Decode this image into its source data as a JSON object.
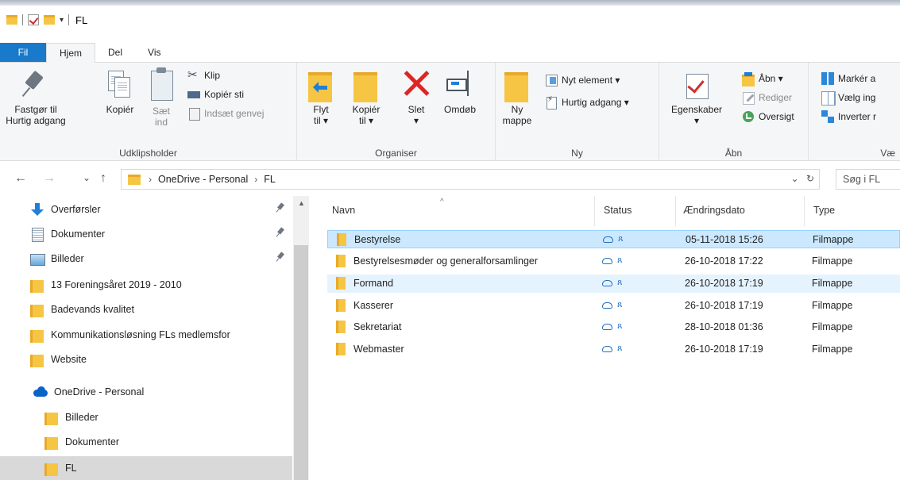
{
  "window": {
    "title": "FL"
  },
  "tabs": [
    {
      "label": "Fil"
    },
    {
      "label": "Hjem"
    },
    {
      "label": "Del"
    },
    {
      "label": "Vis"
    }
  ],
  "ribbon": {
    "clipboard": {
      "group_label": "Udklipsholder",
      "pin_line1": "Fastgør til",
      "pin_line2": "Hurtig adgang",
      "copy": "Kopiér",
      "paste_line1": "Sæt",
      "paste_line2": "ind",
      "cut": "Klip",
      "copy_path": "Kopiér sti",
      "paste_shortcut": "Indsæt genvej"
    },
    "organize": {
      "group_label": "Organiser",
      "move_line1": "Flyt",
      "move_line2": "til ▾",
      "copyto_line1": "Kopiér",
      "copyto_line2": "til ▾",
      "delete_line1": "Slet",
      "delete_line2": "▾",
      "rename": "Omdøb"
    },
    "new": {
      "group_label": "Ny",
      "newfolder_line1": "Ny",
      "newfolder_line2": "mappe",
      "new_item": "Nyt element ▾",
      "quick_access": "Hurtig adgang ▾"
    },
    "open": {
      "group_label": "Åbn",
      "properties_line1": "Egenskaber",
      "properties_line2": "▾",
      "open": "Åbn ▾",
      "edit": "Rediger",
      "history": "Oversigt"
    },
    "select": {
      "group_label": "Væ",
      "select_all": "Markér a",
      "select_none": "Vælg ing",
      "invert": "Inverter r"
    }
  },
  "address": {
    "crumbs": [
      "OneDrive - Personal",
      "FL"
    ],
    "separator": "›",
    "dropdown": "⌄",
    "refresh": "↻",
    "search_placeholder": "Søg i FL"
  },
  "nav": {
    "back": "←",
    "forward": "→",
    "recent": "⌄",
    "up": "↑",
    "items": [
      {
        "label": "Overførsler",
        "icon": "download-icon",
        "pinned": true
      },
      {
        "label": "Dokumenter",
        "icon": "documents-icon",
        "pinned": true
      },
      {
        "label": "Billeder",
        "icon": "pictures-icon",
        "pinned": true
      },
      {
        "label": "13 Foreningsåret 2019 - 2010",
        "icon": "folder-icon"
      },
      {
        "label": "Badevands kvalitet",
        "icon": "folder-icon"
      },
      {
        "label": "Kommunikationsløsning FLs medlemsfor",
        "icon": "folder-icon"
      },
      {
        "label": "Website",
        "icon": "folder-icon"
      },
      {
        "label": "OneDrive - Personal",
        "icon": "onedrive-icon"
      },
      {
        "label": "Billeder",
        "icon": "folder-icon"
      },
      {
        "label": "Dokumenter",
        "icon": "folder-icon"
      },
      {
        "label": "FL",
        "icon": "folder-icon",
        "selected": true
      }
    ]
  },
  "files": {
    "columns": {
      "name": "Navn",
      "status": "Status",
      "date": "Ændringsdato",
      "type": "Type"
    },
    "sort_indicator": "^",
    "rows": [
      {
        "name": "Bestyrelse",
        "date": "05-11-2018 15:26",
        "type": "Filmappe",
        "state": "selected"
      },
      {
        "name": "Bestyrelsesmøder og generalforsamlinger",
        "date": "26-10-2018 17:22",
        "type": "Filmappe"
      },
      {
        "name": "Formand",
        "date": "26-10-2018 17:19",
        "type": "Filmappe",
        "state": "hover"
      },
      {
        "name": "Kasserer",
        "date": "26-10-2018 17:19",
        "type": "Filmappe"
      },
      {
        "name": "Sekretariat",
        "date": "28-10-2018 01:36",
        "type": "Filmappe"
      },
      {
        "name": "Webmaster",
        "date": "26-10-2018 17:19",
        "type": "Filmappe"
      }
    ]
  },
  "colors": {
    "file_tab": "#1979ca",
    "selection": "#cce8ff",
    "hover": "#e5f3ff",
    "folder": "#f6c543"
  }
}
